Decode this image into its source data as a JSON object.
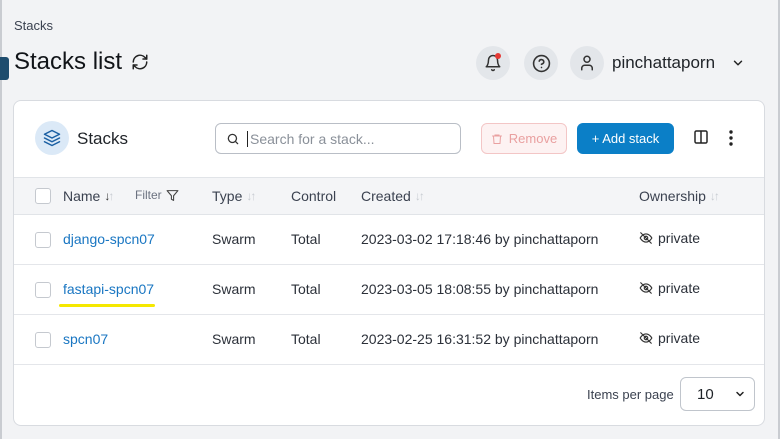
{
  "breadcrumb": "Stacks",
  "page": {
    "title": "Stacks list"
  },
  "user": {
    "name": "pinchattaporn"
  },
  "panel": {
    "title": "Stacks",
    "search_placeholder": "Search for a stack...",
    "remove_label": "Remove",
    "add_label": "+ Add stack"
  },
  "table": {
    "columns": {
      "name": "Name",
      "filter": "Filter",
      "type": "Type",
      "control": "Control",
      "created": "Created",
      "ownership": "Ownership"
    },
    "rows": [
      {
        "name": "django-spcn07",
        "type": "Swarm",
        "control": "Total",
        "created": "2023-03-02 17:18:46 by pinchattaporn",
        "ownership": "private"
      },
      {
        "name": "fastapi-spcn07",
        "type": "Swarm",
        "control": "Total",
        "created": "2023-03-05 18:08:55 by pinchattaporn",
        "ownership": "private"
      },
      {
        "name": "spcn07",
        "type": "Swarm",
        "control": "Total",
        "created": "2023-02-25 16:31:52 by pinchattaporn",
        "ownership": "private"
      }
    ]
  },
  "pagination": {
    "items_per_page_label": "Items per page",
    "items_per_page_value": "10"
  },
  "colors": {
    "primary": "#0b7fc7",
    "link": "#1976c2",
    "danger_light": "#fdf2f2",
    "highlight": "#f5e800"
  }
}
